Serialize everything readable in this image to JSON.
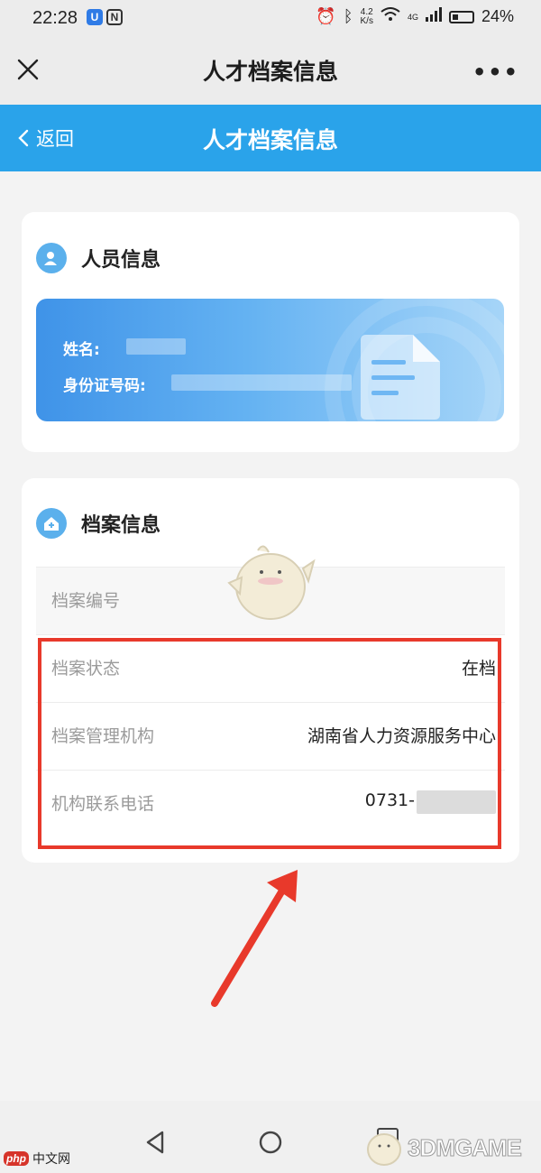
{
  "status_bar": {
    "time": "22:28",
    "speed_value": "4.2",
    "speed_unit": "K/s",
    "network": "4G",
    "battery": "24%"
  },
  "title_bar": {
    "title": "人才档案信息",
    "more": "•••",
    "close_icon": "close-icon"
  },
  "header": {
    "back_label": "返回",
    "title": "人才档案信息",
    "color": "#2aa3ea"
  },
  "person_section": {
    "title": "人员信息",
    "name_label": "姓名:",
    "id_label": "身份证号码:"
  },
  "archive_section": {
    "title": "档案信息",
    "rows": [
      {
        "label": "档案编号",
        "value": ""
      },
      {
        "label": "档案状态",
        "value": "在档"
      },
      {
        "label": "档案管理机构",
        "value": "湖南省人力资源服务中心"
      },
      {
        "label": "机构联系电话",
        "value": "0731-"
      }
    ]
  },
  "annotation": {
    "highlight_color": "#e8392b"
  },
  "watermarks": {
    "left_text": "中文网",
    "left_logo": "php",
    "right_text": "3DMGAME"
  }
}
